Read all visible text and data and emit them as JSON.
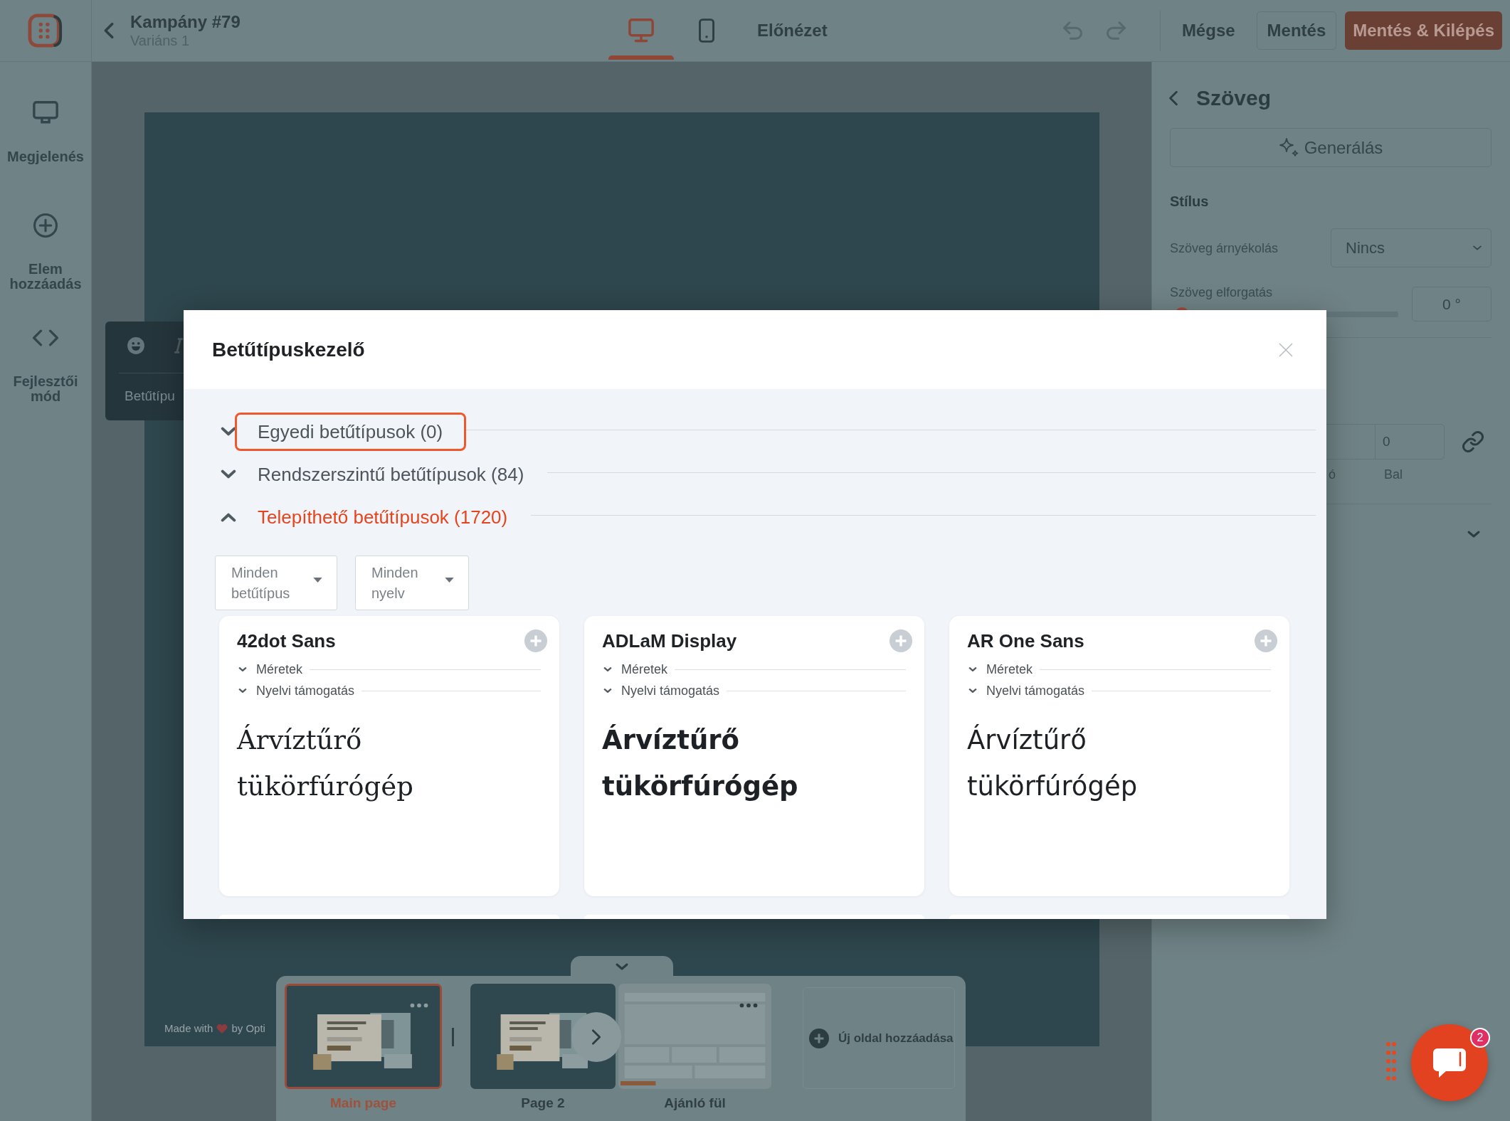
{
  "top_bar": {
    "title": "Kampány #79",
    "subtitle": "Variáns 1",
    "devices": [
      {
        "kind": "desktop",
        "selected": true
      },
      {
        "kind": "mobile",
        "selected": false
      }
    ],
    "preview": "Előnézet",
    "actions": [
      {
        "kind": "text",
        "label": "Mégse"
      },
      {
        "kind": "outline",
        "label": "Mentés"
      },
      {
        "kind": "primary",
        "label": "Mentés & Kilépés"
      }
    ]
  },
  "sidebar": {
    "items": [
      {
        "kind": "appearance",
        "label": "Megjelenés"
      },
      {
        "kind": "add",
        "label": "Elem hozzáadás"
      },
      {
        "kind": "code",
        "label": "Fejlesztői mód"
      }
    ]
  },
  "canvas": {
    "toolbar_label": "Betűtípu",
    "footer": {
      "before": "Made with",
      "after": "by Opti"
    }
  },
  "pages": {
    "items": [
      {
        "label": "Main page",
        "selected": true,
        "kind": "popup",
        "menu": true
      },
      {
        "label": "Page 2",
        "selected": false,
        "kind": "popup",
        "menu": false
      },
      {
        "label": "Ajánló fül",
        "selected": false,
        "kind": "tab",
        "menu": true
      }
    ],
    "add_label": "Új oldal hozzáadása"
  },
  "properties": {
    "title": "Szöveg",
    "generate": "Generálás",
    "section": "Stílus",
    "shadow": {
      "label": "Szöveg árnyékolás",
      "value": "Nincs"
    },
    "rotation": {
      "label": "Szöveg elforgatás",
      "level": 0,
      "value": "0 °"
    },
    "spacing": {
      "fields": [
        {
          "label": "ó"
        },
        {
          "value": "0",
          "label": "Bal"
        }
      ]
    }
  },
  "modal": {
    "title": "Betűtípuskezelő",
    "sections": [
      {
        "label": "Egyedi betűtípusok (0)",
        "expanded": false,
        "highlighted": true
      },
      {
        "label": "Rendszerszintű betűtípusok (84)",
        "expanded": false,
        "highlighted": false
      },
      {
        "label": "Telepíthető betűtípusok (1720)",
        "expanded": true,
        "highlighted": false
      }
    ],
    "filters": [
      {
        "value": "Minden betűtípus"
      },
      {
        "value": "Minden nyelv"
      }
    ],
    "fonts": [
      {
        "name": "42dot Sans",
        "kind": "serif",
        "details": [
          "Méretek",
          "Nyelvi támogatás"
        ],
        "sample": "Árvíztűrő tükörfúrógép"
      },
      {
        "name": "ADLaM Display",
        "kind": "display",
        "details": [
          "Méretek",
          "Nyelvi támogatás"
        ],
        "sample": "Árvíztűrő tükörfúrógép"
      },
      {
        "name": "AR One Sans",
        "kind": "sans",
        "details": [
          "Méretek",
          "Nyelvi támogatás"
        ],
        "sample": "Árvíztűrő tükörfúrógép"
      }
    ]
  },
  "chat": {
    "badge": "2"
  }
}
